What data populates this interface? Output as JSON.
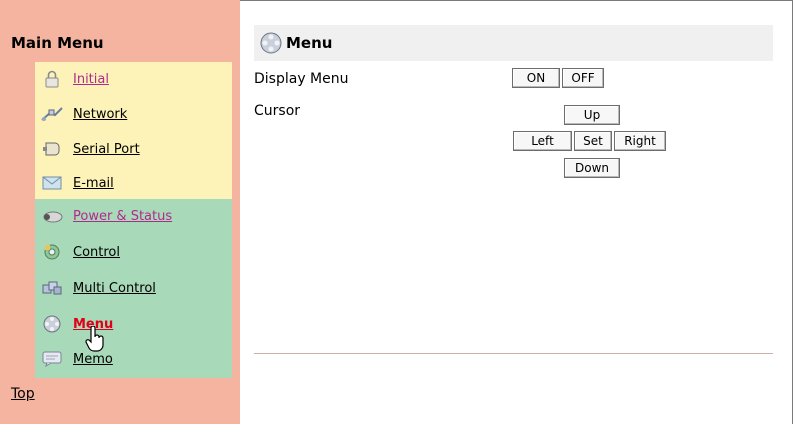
{
  "sidebar": {
    "title": "Main Menu",
    "items": [
      {
        "label": "Initial",
        "icon": "lock-icon"
      },
      {
        "label": "Network",
        "icon": "network-icon"
      },
      {
        "label": "Serial Port",
        "icon": "serial-port-icon"
      },
      {
        "label": "E-mail",
        "icon": "email-icon"
      },
      {
        "label": "Power & Status",
        "icon": "projector-icon"
      },
      {
        "label": "Control",
        "icon": "control-icon"
      },
      {
        "label": "Multi Control",
        "icon": "multi-control-icon"
      },
      {
        "label": "Menu",
        "icon": "menu-icon"
      },
      {
        "label": "Memo",
        "icon": "memo-icon"
      }
    ],
    "active_item": "Menu",
    "top_link": "Top"
  },
  "main": {
    "title": "Menu",
    "display_menu": {
      "label": "Display Menu",
      "on": "ON",
      "off": "OFF"
    },
    "cursor": {
      "label": "Cursor",
      "up": "Up",
      "left": "Left",
      "set": "Set",
      "right": "Right",
      "down": "Down"
    }
  },
  "colors": {
    "sidebar_bg": "#f4b4a0",
    "group1_bg": "#fdf3b8",
    "group2_bg": "#a8d9b8",
    "visited_link": "#b02a8e",
    "active_link": "#e0001a"
  }
}
